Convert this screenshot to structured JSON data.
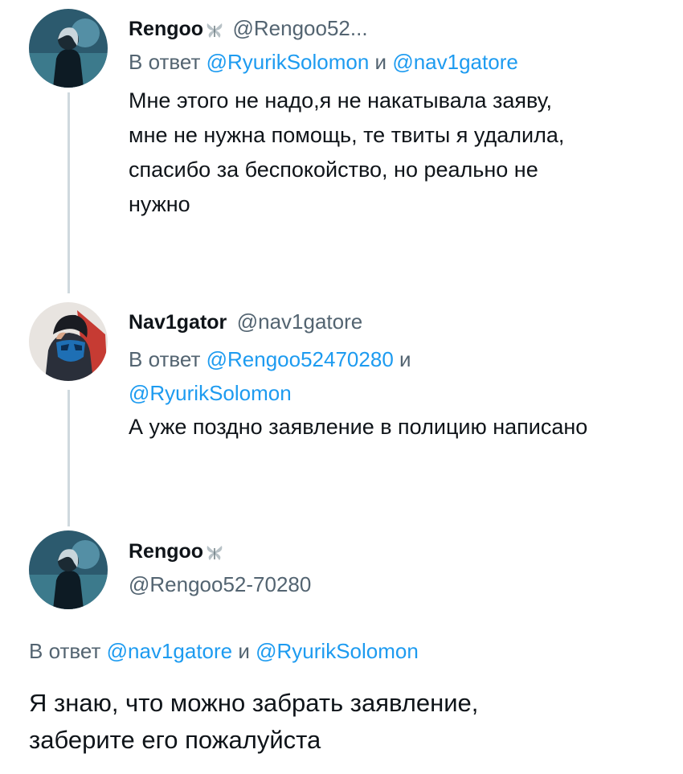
{
  "tweets": [
    {
      "name": "Rengoo",
      "handle": "@Rengoo52...",
      "reply_prefix": "В ответ",
      "mention_1": "@RyurikSolomon",
      "conj": "и",
      "mention_2": "@nav1gatore",
      "text_lines": [
        "Мне этого не надо,я не накатывала заяву,",
        "мне не нужна помощь, те твиты я удалила,",
        "спасибо за беспокойство, но реально не",
        "нужно"
      ]
    },
    {
      "name": "Nav1gator",
      "handle": "@nav1gatore",
      "reply_prefix": "В ответ",
      "mention_1": "@Rengoo52470280",
      "conj": "и",
      "mention_2": "@RyurikSolomon",
      "text": "А уже поздно заявление в полицию написано"
    },
    {
      "name": "Rengoo",
      "handle": "@Rengoo52-70280",
      "reply_prefix": "В ответ",
      "mention_1": "@nav1gatore",
      "conj": "и",
      "mention_2": "@RyurikSolomon",
      "text_lines": [
        "Я знаю, что можно забрать заявление,",
        "заберите его пожалуйста"
      ]
    }
  ],
  "colors": {
    "text": "#0f1419",
    "muted": "#536471",
    "link": "#1d9bf0",
    "thread_line": "#cfd9de"
  },
  "icons": {
    "badge": "butterfly-badge-icon"
  }
}
